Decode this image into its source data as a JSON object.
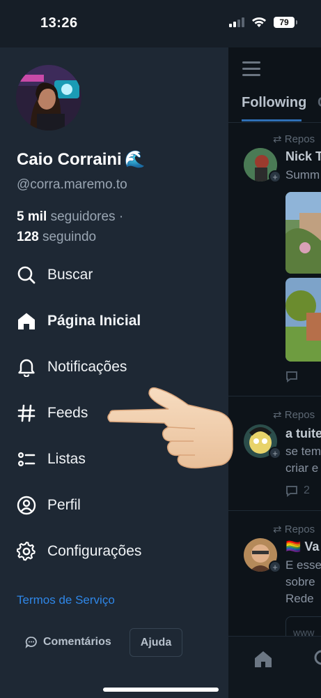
{
  "status_bar": {
    "time": "13:26",
    "battery": "79"
  },
  "drawer": {
    "display_name": "Caio Corraini",
    "name_emoji": "🌊",
    "handle": "@corra.maremo.to",
    "followers_count": "5 mil",
    "followers_label": "seguidores ·",
    "following_count": "128",
    "following_label": "seguindo",
    "menu": [
      {
        "label": "Buscar",
        "icon": "search-icon"
      },
      {
        "label": "Página Inicial",
        "icon": "home-icon"
      },
      {
        "label": "Notificações",
        "icon": "bell-icon"
      },
      {
        "label": "Feeds",
        "icon": "hash-icon"
      },
      {
        "label": "Listas",
        "icon": "list-icon"
      },
      {
        "label": "Perfil",
        "icon": "user-circle-icon"
      },
      {
        "label": "Configurações",
        "icon": "gear-icon"
      }
    ],
    "terms_label": "Termos de Serviço",
    "comments_label": "Comentários",
    "help_label": "Ajuda"
  },
  "feed": {
    "tab_active": "Following",
    "tab_next": "C",
    "posts": [
      {
        "repost_label": "Repos",
        "author": "Nick T",
        "snippet_1": "Summ",
        "snippet_2": ""
      },
      {
        "repost_label": "Repos",
        "author": "a tuite",
        "snippet_1": "se tem",
        "snippet_2": "criar e",
        "reply_count": "2"
      },
      {
        "repost_label": "Repos",
        "author": "🏳️‍🌈 Va",
        "snippet_1": "E esse",
        "snippet_2": "sobre",
        "snippet_3": "Rede",
        "link_preview": "www"
      }
    ]
  },
  "colors": {
    "drawer_bg": "#1e2834",
    "accent_link": "#2f87e8",
    "feed_bg": "#0d1319"
  }
}
